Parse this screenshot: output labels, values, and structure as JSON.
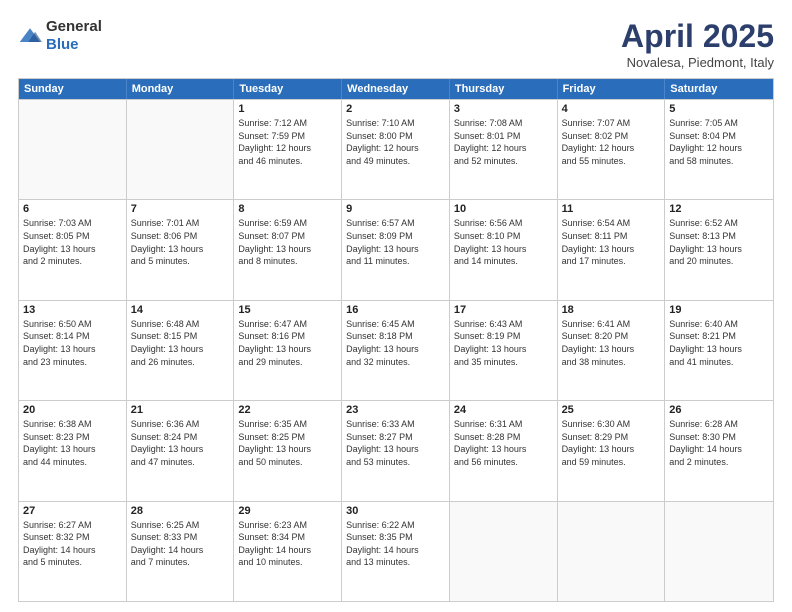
{
  "logo": {
    "general": "General",
    "blue": "Blue"
  },
  "title": "April 2025",
  "subtitle": "Novalesa, Piedmont, Italy",
  "header_days": [
    "Sunday",
    "Monday",
    "Tuesday",
    "Wednesday",
    "Thursday",
    "Friday",
    "Saturday"
  ],
  "rows": [
    [
      {
        "day": "",
        "info": ""
      },
      {
        "day": "",
        "info": ""
      },
      {
        "day": "1",
        "info": "Sunrise: 7:12 AM\nSunset: 7:59 PM\nDaylight: 12 hours\nand 46 minutes."
      },
      {
        "day": "2",
        "info": "Sunrise: 7:10 AM\nSunset: 8:00 PM\nDaylight: 12 hours\nand 49 minutes."
      },
      {
        "day": "3",
        "info": "Sunrise: 7:08 AM\nSunset: 8:01 PM\nDaylight: 12 hours\nand 52 minutes."
      },
      {
        "day": "4",
        "info": "Sunrise: 7:07 AM\nSunset: 8:02 PM\nDaylight: 12 hours\nand 55 minutes."
      },
      {
        "day": "5",
        "info": "Sunrise: 7:05 AM\nSunset: 8:04 PM\nDaylight: 12 hours\nand 58 minutes."
      }
    ],
    [
      {
        "day": "6",
        "info": "Sunrise: 7:03 AM\nSunset: 8:05 PM\nDaylight: 13 hours\nand 2 minutes."
      },
      {
        "day": "7",
        "info": "Sunrise: 7:01 AM\nSunset: 8:06 PM\nDaylight: 13 hours\nand 5 minutes."
      },
      {
        "day": "8",
        "info": "Sunrise: 6:59 AM\nSunset: 8:07 PM\nDaylight: 13 hours\nand 8 minutes."
      },
      {
        "day": "9",
        "info": "Sunrise: 6:57 AM\nSunset: 8:09 PM\nDaylight: 13 hours\nand 11 minutes."
      },
      {
        "day": "10",
        "info": "Sunrise: 6:56 AM\nSunset: 8:10 PM\nDaylight: 13 hours\nand 14 minutes."
      },
      {
        "day": "11",
        "info": "Sunrise: 6:54 AM\nSunset: 8:11 PM\nDaylight: 13 hours\nand 17 minutes."
      },
      {
        "day": "12",
        "info": "Sunrise: 6:52 AM\nSunset: 8:13 PM\nDaylight: 13 hours\nand 20 minutes."
      }
    ],
    [
      {
        "day": "13",
        "info": "Sunrise: 6:50 AM\nSunset: 8:14 PM\nDaylight: 13 hours\nand 23 minutes."
      },
      {
        "day": "14",
        "info": "Sunrise: 6:48 AM\nSunset: 8:15 PM\nDaylight: 13 hours\nand 26 minutes."
      },
      {
        "day": "15",
        "info": "Sunrise: 6:47 AM\nSunset: 8:16 PM\nDaylight: 13 hours\nand 29 minutes."
      },
      {
        "day": "16",
        "info": "Sunrise: 6:45 AM\nSunset: 8:18 PM\nDaylight: 13 hours\nand 32 minutes."
      },
      {
        "day": "17",
        "info": "Sunrise: 6:43 AM\nSunset: 8:19 PM\nDaylight: 13 hours\nand 35 minutes."
      },
      {
        "day": "18",
        "info": "Sunrise: 6:41 AM\nSunset: 8:20 PM\nDaylight: 13 hours\nand 38 minutes."
      },
      {
        "day": "19",
        "info": "Sunrise: 6:40 AM\nSunset: 8:21 PM\nDaylight: 13 hours\nand 41 minutes."
      }
    ],
    [
      {
        "day": "20",
        "info": "Sunrise: 6:38 AM\nSunset: 8:23 PM\nDaylight: 13 hours\nand 44 minutes."
      },
      {
        "day": "21",
        "info": "Sunrise: 6:36 AM\nSunset: 8:24 PM\nDaylight: 13 hours\nand 47 minutes."
      },
      {
        "day": "22",
        "info": "Sunrise: 6:35 AM\nSunset: 8:25 PM\nDaylight: 13 hours\nand 50 minutes."
      },
      {
        "day": "23",
        "info": "Sunrise: 6:33 AM\nSunset: 8:27 PM\nDaylight: 13 hours\nand 53 minutes."
      },
      {
        "day": "24",
        "info": "Sunrise: 6:31 AM\nSunset: 8:28 PM\nDaylight: 13 hours\nand 56 minutes."
      },
      {
        "day": "25",
        "info": "Sunrise: 6:30 AM\nSunset: 8:29 PM\nDaylight: 13 hours\nand 59 minutes."
      },
      {
        "day": "26",
        "info": "Sunrise: 6:28 AM\nSunset: 8:30 PM\nDaylight: 14 hours\nand 2 minutes."
      }
    ],
    [
      {
        "day": "27",
        "info": "Sunrise: 6:27 AM\nSunset: 8:32 PM\nDaylight: 14 hours\nand 5 minutes."
      },
      {
        "day": "28",
        "info": "Sunrise: 6:25 AM\nSunset: 8:33 PM\nDaylight: 14 hours\nand 7 minutes."
      },
      {
        "day": "29",
        "info": "Sunrise: 6:23 AM\nSunset: 8:34 PM\nDaylight: 14 hours\nand 10 minutes."
      },
      {
        "day": "30",
        "info": "Sunrise: 6:22 AM\nSunset: 8:35 PM\nDaylight: 14 hours\nand 13 minutes."
      },
      {
        "day": "",
        "info": ""
      },
      {
        "day": "",
        "info": ""
      },
      {
        "day": "",
        "info": ""
      }
    ]
  ]
}
